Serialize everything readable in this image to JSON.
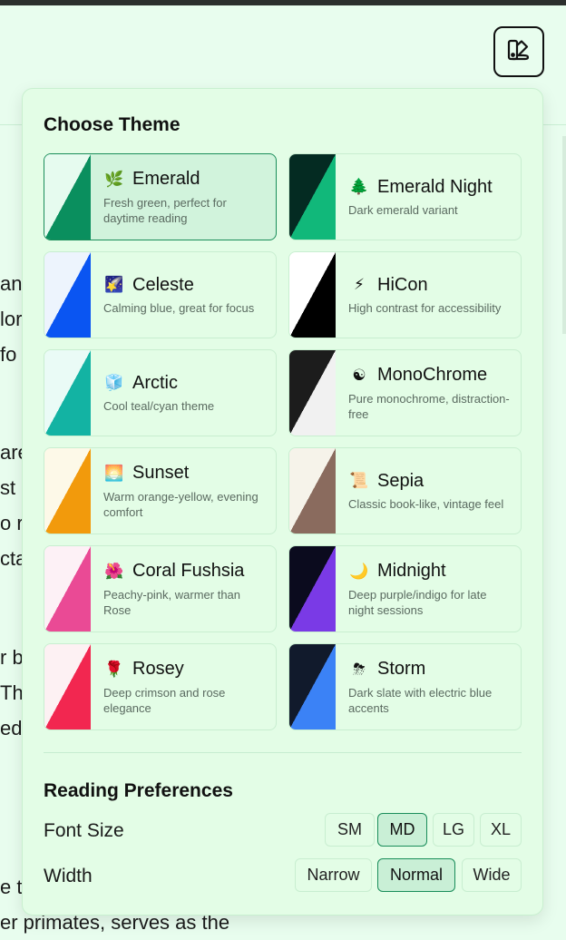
{
  "header": {
    "theme_toggle_icon": "palette-icon"
  },
  "background_text": [
    "an",
    "lor",
    "fo",
    "are",
    "st",
    "o r",
    "cta",
    "r b",
    "Th",
    "ed",
    "e t",
    "er primates, serves as the"
  ],
  "panel": {
    "title": "Choose Theme",
    "themes": [
      {
        "name": "Emerald",
        "desc": "Fresh green, perfect for daytime reading",
        "emoji": "🌿",
        "icon": "herb-icon",
        "top": "#e6fbef",
        "bottom": "#0a8f5e",
        "selected": true
      },
      {
        "name": "Emerald Night",
        "desc": "Dark emerald variant",
        "emoji": "🌲",
        "icon": "evergreen-tree-icon",
        "top": "#042b22",
        "bottom": "#11b87a",
        "selected": false
      },
      {
        "name": "Celeste",
        "desc": "Calming blue, great for focus",
        "emoji": "🌠",
        "icon": "shooting-star-icon",
        "top": "#edf4fd",
        "bottom": "#0a55f2",
        "selected": false
      },
      {
        "name": "HiCon",
        "desc": "High contrast for accessibility",
        "emoji": "⚡",
        "icon": "lightning-icon",
        "top": "#ffffff",
        "bottom": "#000000",
        "selected": false
      },
      {
        "name": "Arctic",
        "desc": "Cool teal/cyan theme",
        "emoji": "🧊",
        "icon": "ice-cube-icon",
        "top": "#eafbf6",
        "bottom": "#13b3a3",
        "selected": false
      },
      {
        "name": "MonoChrome",
        "desc": "Pure monochrome, distraction-free",
        "emoji": "☯",
        "icon": "yin-yang-icon",
        "top": "#1c1c1c",
        "bottom": "#f1f1f1",
        "selected": false
      },
      {
        "name": "Sunset",
        "desc": "Warm orange-yellow, evening comfort",
        "emoji": "🌅",
        "icon": "sunrise-icon",
        "top": "#fdf9e8",
        "bottom": "#f29a0c",
        "selected": false
      },
      {
        "name": "Sepia",
        "desc": "Classic book-like, vintage feel",
        "emoji": "📜",
        "icon": "scroll-icon",
        "top": "#f6f3ea",
        "bottom": "#8a6b5e",
        "selected": false
      },
      {
        "name": "Coral Fushsia",
        "desc": "Peachy-pink, warmer than Rose",
        "emoji": "🌺",
        "icon": "hibiscus-icon",
        "top": "#fdf1f6",
        "bottom": "#ea4a95",
        "selected": false
      },
      {
        "name": "Midnight",
        "desc": "Deep purple/indigo for late night sessions",
        "emoji": "🌙",
        "icon": "crescent-moon-icon",
        "top": "#0b0b1e",
        "bottom": "#7a3ae6",
        "selected": false
      },
      {
        "name": "Rosey",
        "desc": "Deep crimson and rose elegance",
        "emoji": "🌹",
        "icon": "rose-icon",
        "top": "#fdf1f3",
        "bottom": "#f22750",
        "selected": false
      },
      {
        "name": "Storm",
        "desc": "Dark slate with electric blue accents",
        "emoji": "⛈",
        "icon": "storm-cloud-icon",
        "top": "#111a2c",
        "bottom": "#3b82f6",
        "selected": false
      }
    ],
    "prefs_title": "Reading Preferences",
    "font_size": {
      "label": "Font Size",
      "options": [
        "SM",
        "MD",
        "LG",
        "XL"
      ],
      "selected": "MD"
    },
    "width": {
      "label": "Width",
      "options": [
        "Narrow",
        "Normal",
        "Wide"
      ],
      "selected": "Normal"
    }
  }
}
